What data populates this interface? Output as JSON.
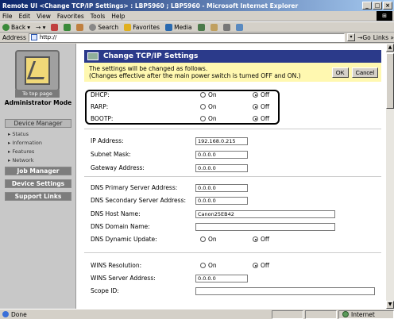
{
  "window": {
    "title": "Remote UI <Change TCP/IP Settings> : LBP5960 ; LBP5960 - Microsoft Internet Explorer"
  },
  "menu": [
    "File",
    "Edit",
    "View",
    "Favorites",
    "Tools",
    "Help"
  ],
  "toolbar": {
    "back": "Back",
    "search": "Search",
    "favorites": "Favorites",
    "media": "Media"
  },
  "address": {
    "label": "Address",
    "value": "http://",
    "go": "Go",
    "links": "Links"
  },
  "sidebar": {
    "to_top_page": "To top page",
    "mode": "Administrator Mode",
    "device_manager": "Device Manager",
    "subitems": [
      "Status",
      "Information",
      "Features",
      "Network"
    ],
    "job_manager": "Job Manager",
    "device_settings": "Device Settings",
    "support_links": "Support Links"
  },
  "page": {
    "title": "Change TCP/IP Settings",
    "notice_line1": "The settings will be changed as follows.",
    "notice_line2": "(Changes effective after the main power switch is turned OFF and ON.)",
    "ok": "OK",
    "cancel": "Cancel"
  },
  "radio": {
    "on": "On",
    "off": "Off"
  },
  "boot": [
    {
      "label": "DHCP:",
      "selected": "off"
    },
    {
      "label": "RARP:",
      "selected": "off"
    },
    {
      "label": "BOOTP:",
      "selected": "off"
    }
  ],
  "ip": {
    "ip_label": "IP Address:",
    "ip_value": "192.168.0.215",
    "mask_label": "Subnet Mask:",
    "mask_value": "0.0.0.0",
    "gw_label": "Gateway Address:",
    "gw_value": "0.0.0.0"
  },
  "dns": {
    "primary_label": "DNS Primary Server Address:",
    "primary_value": "0.0.0.0",
    "secondary_label": "DNS Secondary Server Address:",
    "secondary_value": "0.0.0.0",
    "host_label": "DNS Host Name:",
    "host_value": "Canon25EB42",
    "domain_label": "DNS Domain Name:",
    "domain_value": "",
    "dynamic_label": "DNS Dynamic Update:",
    "dynamic_selected": "off"
  },
  "wins": {
    "resolution_label": "WINS Resolution:",
    "resolution_selected": "off",
    "server_label": "WINS Server Address:",
    "server_value": "0.0.0.0",
    "scope_label": "Scope ID:",
    "scope_value": ""
  },
  "status": {
    "text": "Done",
    "zone": "Internet"
  }
}
